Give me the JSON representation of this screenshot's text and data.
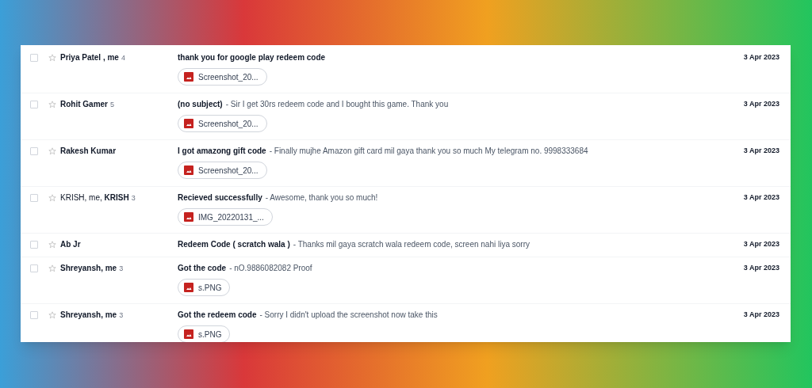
{
  "emails": [
    {
      "sender": "Priya Patel , me",
      "count": "4",
      "subject": "thank you for google play redeem code",
      "attachment": "Screenshot_20...",
      "date": "3 Apr 2023",
      "checked": false,
      "starred": false
    },
    {
      "sender": "Rohit Gamer",
      "count": "5",
      "subject": "(no subject)",
      "snippet": "- Sir I get 30rs redeem code and I bought this game. Thank you",
      "attachment": "Screenshot_20...",
      "date": "3 Apr 2023",
      "checked": false,
      "starred": false
    },
    {
      "sender": "Rakesh Kumar",
      "subject": "I got amazong gift code",
      "snippet": "- Finally mujhe Amazon gift card mil gaya thank you so much My telegram no. 9998333684",
      "attachment": "Screenshot_20...",
      "date": "3 Apr 2023",
      "checked": false,
      "starred": false
    },
    {
      "sender": "KRISH, me, **KRISH**",
      "count": "3",
      "subject": "Recieved successfully",
      "snippet": "- Awesome, thank you so much!",
      "attachment": "IMG_20220131_...",
      "date": "3 Apr 2023",
      "checked": false,
      "starred": false
    },
    {
      "sender": "Ab Jr",
      "subject": "Redeem Code ( scratch wala )",
      "snippet": "- Thanks mil gaya scratch wala redeem code, screen nahi liya sorry",
      "date": "3 Apr 2023",
      "checked": false,
      "starred": false
    },
    {
      "sender": "Shreyansh, me",
      "count": "3",
      "subject": "Got the code",
      "snippet": "- nO.9886082082 Proof",
      "attachment": "s.PNG",
      "date": "3 Apr 2023",
      "checked": false,
      "starred": false
    },
    {
      "sender": "Shreyansh, me",
      "count": "3",
      "subject": "Got the redeem code",
      "snippet": "- Sorry I didn't upload the screenshot now take this",
      "attachment": "s.PNG",
      "date": "3 Apr 2023",
      "checked": false,
      "starred": false
    }
  ]
}
